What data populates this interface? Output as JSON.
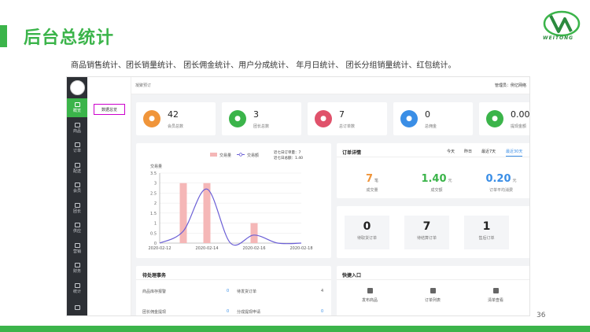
{
  "slide": {
    "title": "后台总统计",
    "subtitle": "商品销售统计、团长销量统计、 团长佣金统计、用户分成统计、 年月日统计、 团长分组销量统计、红包统计。",
    "page_number": "36",
    "logo_text": "WEITONG",
    "colors": {
      "accent": "#3bb44a",
      "sidebar": "#2d3035",
      "link": "#3a8ee6"
    }
  },
  "sidebar": {
    "items": [
      {
        "label": "概览",
        "icon": "home-icon",
        "active": true
      },
      {
        "label": "商品",
        "icon": "goods-icon",
        "active": false
      },
      {
        "label": "订单",
        "icon": "order-icon",
        "active": false
      },
      {
        "label": "配送",
        "icon": "delivery-icon",
        "active": false
      },
      {
        "label": "会员",
        "icon": "member-icon",
        "active": false
      },
      {
        "label": "团长",
        "icon": "leader-icon",
        "active": false
      },
      {
        "label": "供应",
        "icon": "supply-icon",
        "active": false
      },
      {
        "label": "营销",
        "icon": "marketing-icon",
        "active": false
      },
      {
        "label": "财务",
        "icon": "finance-icon",
        "active": false
      },
      {
        "label": "统计",
        "icon": "stats-icon",
        "active": false
      },
      {
        "label": "",
        "icon": "gear-icon",
        "active": false
      }
    ]
  },
  "submenu": {
    "item": "数据总览"
  },
  "topbar": {
    "breadcrumb": "凝聚预订",
    "admin": "管理员：例亿网络"
  },
  "stats": [
    {
      "value": "42",
      "label": "会员总数",
      "color": "#f0953a",
      "icon": "user-icon"
    },
    {
      "value": "3",
      "label": "团长总数",
      "color": "#3bb44a",
      "icon": "leader-icon"
    },
    {
      "value": "7",
      "label": "总订单数",
      "color": "#e0526b",
      "icon": "order-icon"
    },
    {
      "value": "0",
      "label": "总佣金",
      "color": "#3a8ee6",
      "icon": "money-icon"
    },
    {
      "value": "0.00",
      "label": "提现金额",
      "color": "#3bb44a",
      "icon": "pie-icon"
    }
  ],
  "chart_data": {
    "type": "bar",
    "title": "",
    "ylabel": "交易量",
    "xlabel": "",
    "legend": [
      "交易量",
      "交易额"
    ],
    "legend_position": "top",
    "info": [
      "近七日订单量：7",
      "近七日总额：1.40"
    ],
    "x_ticks": [
      "2020-02-12",
      "2020-02-14",
      "2020-02-16",
      "2020-02-18"
    ],
    "y_ticks": [
      "0",
      "0.5",
      "1",
      "1.5",
      "2",
      "2.5",
      "3",
      "3.5"
    ],
    "ylim": [
      0,
      3.5
    ],
    "bar_series": {
      "name": "交易量",
      "x": [
        "2020-02-13",
        "2020-02-14",
        "2020-02-16"
      ],
      "values": [
        3,
        3,
        1
      ]
    },
    "line_series": {
      "name": "交易额",
      "x": [
        "2020-02-12",
        "2020-02-13",
        "2020-02-14",
        "2020-02-15",
        "2020-02-16",
        "2020-02-17",
        "2020-02-18"
      ],
      "values": [
        0,
        0.6,
        2.7,
        0,
        0.4,
        0,
        0
      ]
    }
  },
  "order_detail": {
    "title": "订单详情",
    "periods": [
      {
        "label": "今天",
        "active": false
      },
      {
        "label": "昨日",
        "active": false
      },
      {
        "label": "最近7天",
        "active": false
      },
      {
        "label": "最近30天",
        "active": true
      }
    ],
    "metrics": [
      {
        "value": "7",
        "unit": "笔",
        "label": "成交量",
        "color": "#f0953a"
      },
      {
        "value": "1.40",
        "unit": "元",
        "label": "成交额",
        "color": "#3bb44a"
      },
      {
        "value": "0.20",
        "unit": "元",
        "label": "订单平均消费",
        "color": "#3a8ee6"
      }
    ]
  },
  "pending": [
    {
      "value": "0",
      "label": "待取货订单"
    },
    {
      "value": "7",
      "label": "待结算订单"
    },
    {
      "value": "1",
      "label": "售后订单"
    }
  ],
  "todo": {
    "title": "待处理事务",
    "rows": [
      {
        "label": "商品库存报警",
        "value": "0"
      },
      {
        "label": "待发货订单",
        "value": "4"
      },
      {
        "label": "团长佣金提现",
        "value": "0"
      },
      {
        "label": "分成提现申请",
        "value": "0"
      }
    ]
  },
  "quick": {
    "title": "快捷入口",
    "items": [
      {
        "label": "发布商品",
        "icon": "bag-icon"
      },
      {
        "label": "订单列表",
        "icon": "list-icon"
      },
      {
        "label": "清单查看",
        "icon": "clipboard-icon"
      }
    ]
  }
}
